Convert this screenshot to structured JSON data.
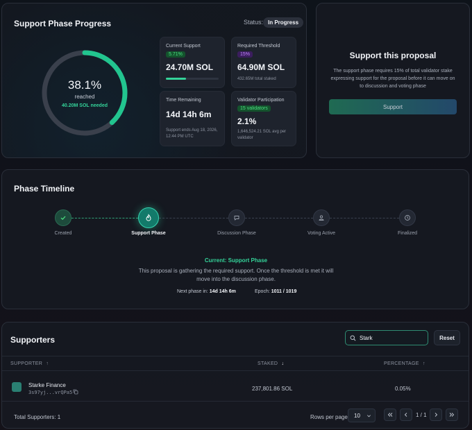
{
  "progress": {
    "title": "Support Phase Progress",
    "status_label": "Status:",
    "status_value": "In Progress",
    "ring": {
      "percent_text": "38.1%",
      "reached_label": "reached",
      "needed_text": "40.20M SOL needed",
      "fraction": 0.381
    },
    "stats": {
      "current_support": {
        "label": "Current Support",
        "chip": "5.71%",
        "value": "24.70M SOL",
        "bar_fraction": 0.381
      },
      "required_threshold": {
        "label": "Required Threshold",
        "chip": "15%",
        "value": "64.90M SOL",
        "note": "432.65M total staked"
      },
      "time_remaining": {
        "label": "Time Remaining",
        "value": "14d 14h 6m",
        "note": "Support ends Aug 18, 2026, 12:44 PM UTC"
      },
      "validator_participation": {
        "label": "Validator Participation",
        "chip": "15 validators",
        "value": "2.1%",
        "note": "1,646,524.21 SOL avg per validator"
      }
    }
  },
  "proposal": {
    "title": "Support this proposal",
    "description": "The support phase requires 15% of total validator stake expressing support for the proposal before it can move on to discussion and voting phase",
    "button_label": "Support"
  },
  "timeline": {
    "title": "Phase Timeline",
    "steps": [
      {
        "label": "Created",
        "state": "done",
        "icon": "check-icon"
      },
      {
        "label": "Support Phase",
        "state": "active",
        "icon": "flame-icon"
      },
      {
        "label": "Discussion Phase",
        "state": "pending",
        "icon": "chat-icon"
      },
      {
        "label": "Voting Active",
        "state": "pending",
        "icon": "vote-icon"
      },
      {
        "label": "Finalized",
        "state": "pending",
        "icon": "clock-icon"
      }
    ],
    "current_phase": "Current: Support Phase",
    "current_description": "This proposal is gathering the required support. Once the threshold is met it will move into the discussion phase.",
    "next_phase_label": "Next phase in:",
    "next_phase_value": "14d 14h 6m",
    "epoch_label": "Epoch:",
    "epoch_value": "1011 / 1019"
  },
  "supporters": {
    "title": "Supporters",
    "search": {
      "value": "Stark",
      "placeholder": ""
    },
    "reset_label": "Reset",
    "columns": {
      "supporter": "SUPPORTER",
      "staked": "STAKED",
      "percentage": "PERCENTAGE"
    },
    "rows": [
      {
        "name": "Starke Finance",
        "address": "3s97yj...vrQPa5",
        "staked": "237,801.86 SOL",
        "percentage": "0.05%"
      }
    ],
    "total_label": "Total Supporters: 1",
    "rows_per_page_label": "Rows per page",
    "rows_per_page_value": "10",
    "page_text": "1 / 1"
  },
  "colors": {
    "accent": "#34d399",
    "purple": "#c084fc",
    "background": "#0e131a"
  }
}
